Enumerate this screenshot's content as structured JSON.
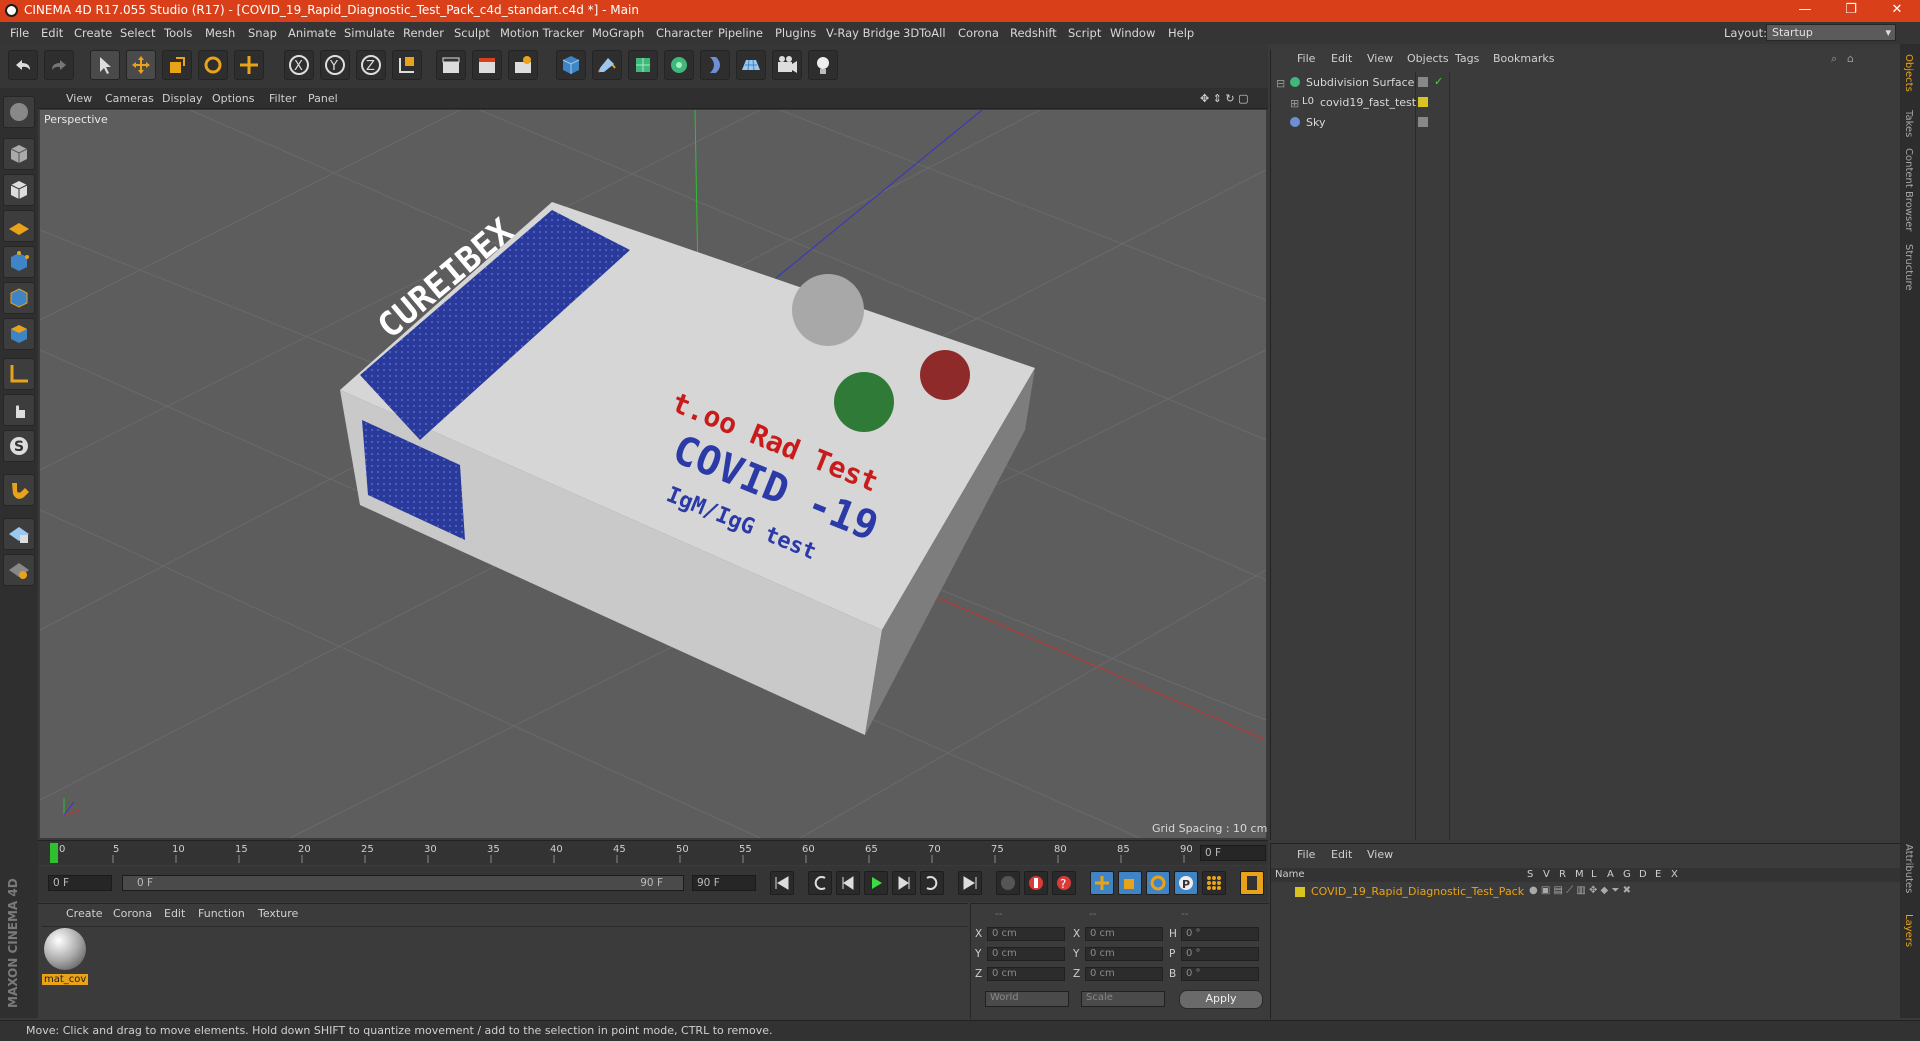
{
  "window": {
    "title": "CINEMA 4D R17.055 Studio (R17) - [COVID_19_Rapid_Diagnostic_Test_Pack_c4d_standart.c4d *] - Main",
    "minimize": "—",
    "restore": "❐",
    "close": "✕"
  },
  "menubar": {
    "items": [
      "File",
      "Edit",
      "Create",
      "Select",
      "Tools",
      "Mesh",
      "Snap",
      "Animate",
      "Simulate",
      "Render",
      "Sculpt",
      "Motion Tracker",
      "MoGraph",
      "Character",
      "Pipeline",
      "Plugins",
      "V-Ray Bridge",
      "3DToAll",
      "Corona",
      "Redshift",
      "Script",
      "Window",
      "Help"
    ],
    "layout_label": "Layout:",
    "layout_value": "Startup"
  },
  "viewport": {
    "menu": [
      "View",
      "Cameras",
      "Display",
      "Options",
      "Filter",
      "Panel"
    ],
    "camera": "Perspective",
    "grid_spacing": "Grid Spacing : 10 cm",
    "box_texture": {
      "brand": "CUREIBEX",
      "line1": "t.oo Rad Test",
      "line2": "COVID -19",
      "line3": "IgM/IgG test"
    }
  },
  "timeline": {
    "ticks": [
      "0",
      "5",
      "10",
      "15",
      "20",
      "25",
      "30",
      "35",
      "40",
      "45",
      "50",
      "55",
      "60",
      "65",
      "70",
      "75",
      "80",
      "85",
      "90"
    ],
    "current_frame": "0 F",
    "start_frame": "0 F",
    "slider_start": "0 F",
    "slider_end": "90 F",
    "end_frame": "90 F"
  },
  "material_manager": {
    "menu": [
      "Create",
      "Corona",
      "Edit",
      "Function",
      "Texture"
    ],
    "materials": [
      {
        "name": "mat_cov"
      }
    ]
  },
  "coordinates": {
    "headers": [
      "--",
      "--",
      "--"
    ],
    "rows": [
      {
        "l1": "X",
        "v1": "0 cm",
        "l2": "X",
        "v2": "0 cm",
        "l3": "H",
        "v3": "0 °"
      },
      {
        "l1": "Y",
        "v1": "0 cm",
        "l2": "Y",
        "v2": "0 cm",
        "l3": "P",
        "v3": "0 °"
      },
      {
        "l1": "Z",
        "v1": "0 cm",
        "l2": "Z",
        "v2": "0 cm",
        "l3": "B",
        "v3": "0 °"
      }
    ],
    "world": "World",
    "scale": "Scale",
    "apply": "Apply"
  },
  "object_manager": {
    "menu": [
      "File",
      "Edit",
      "View",
      "Objects",
      "Tags",
      "Bookmarks"
    ],
    "objects": [
      {
        "name": "Subdivision Surface",
        "icon": "subdivision-icon"
      },
      {
        "name": "covid19_fast_test",
        "icon": "null-icon"
      },
      {
        "name": "Sky",
        "icon": "sky-icon"
      }
    ]
  },
  "layer_manager": {
    "menu": [
      "File",
      "Edit",
      "View"
    ],
    "columns": [
      "Name",
      "S",
      "V",
      "R",
      "M",
      "L",
      "A",
      "G",
      "D",
      "E",
      "X"
    ],
    "layers": [
      {
        "name": "COVID_19_Rapid_Diagnostic_Test_Pack",
        "color": "#d8c320"
      }
    ]
  },
  "right_tabs": [
    "Objects",
    "Takes",
    "Content Browser",
    "Structure"
  ],
  "right_tabs_bottom": [
    "Attributes",
    "Layers"
  ],
  "brand": "MAXON CINEMA 4D",
  "status": "Move: Click and drag to move elements. Hold down SHIFT to quantize movement / add to the selection in point mode, CTRL to remove.",
  "colors": {
    "titlebar": "#d9401a",
    "accent_orange": "#e8a31a",
    "active_blue": "#3f84c4"
  }
}
